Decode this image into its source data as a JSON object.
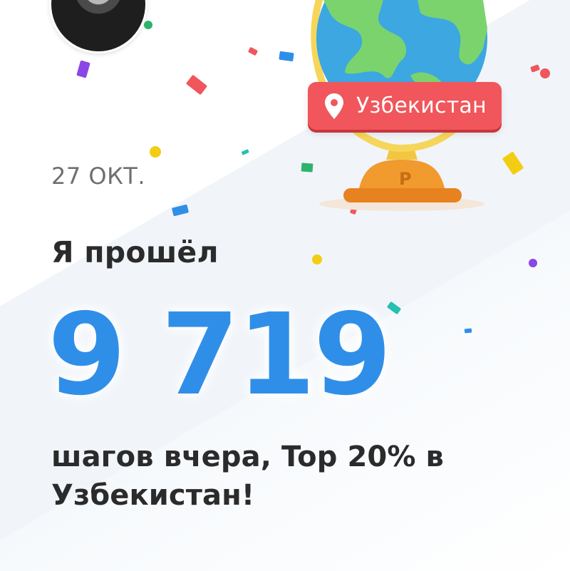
{
  "profile": {
    "avatar_alt": ""
  },
  "badge": {
    "country": "Узбекистан",
    "icon": "location-pin-icon",
    "color": "#f0565b"
  },
  "card": {
    "date": "27 ОКТ.",
    "headline": "Я прошёл",
    "steps": "9 719",
    "summary": "шагов вчера, Top 20% в Узбекистан!",
    "accent": "#2f8fe8",
    "text_color": "#2b2b2b"
  },
  "decor": {
    "globe_icon": "globe-trophy-icon",
    "confetti": true
  }
}
